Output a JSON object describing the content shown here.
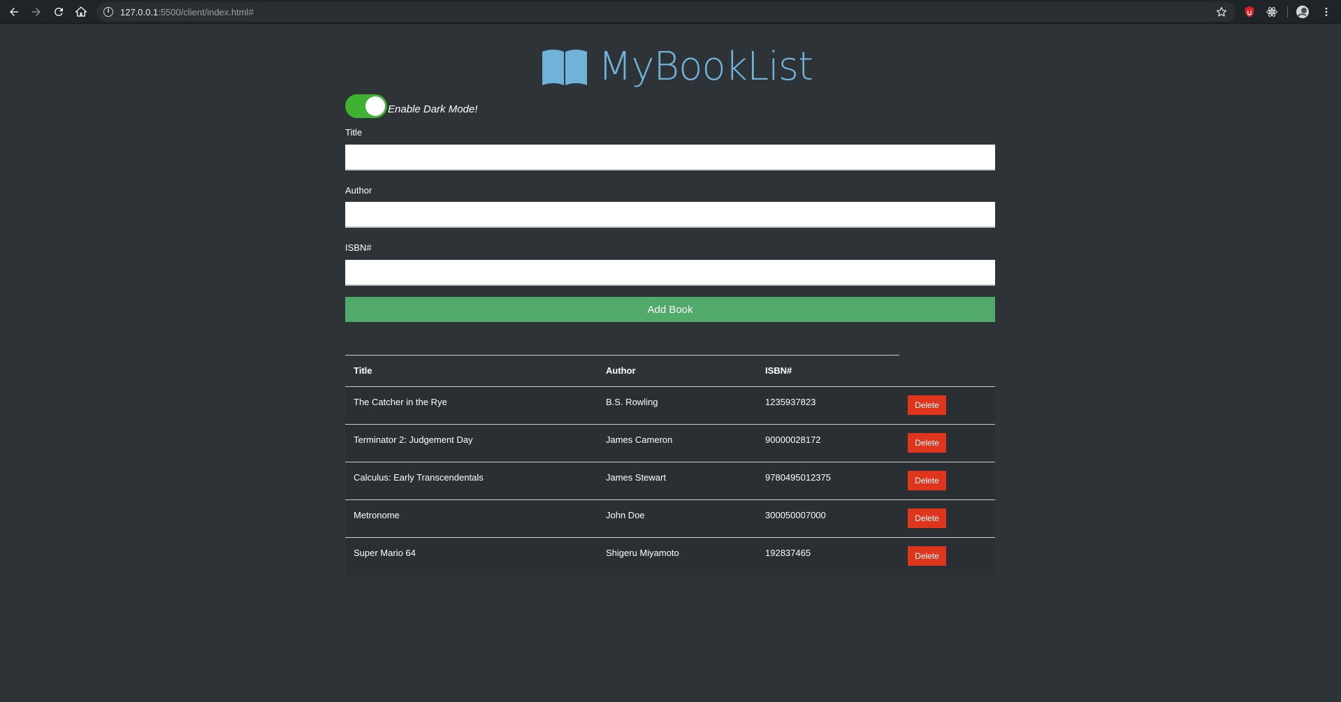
{
  "browser": {
    "url_host": "127.0.0.1",
    "url_path": ":5500/client/index.html#",
    "icons": [
      "back-arrow-icon",
      "forward-arrow-icon",
      "reload-icon",
      "home-icon",
      "info-icon",
      "star-icon",
      "shield-extension-icon",
      "react-extension-icon",
      "profile-icon",
      "menu-icon"
    ]
  },
  "header": {
    "title": "MyBookList",
    "logo_icon": "open-book-icon",
    "logo_color": "#6fb3d8"
  },
  "dark_mode": {
    "label": "Enable Dark Mode!",
    "enabled": true,
    "color": "#3fb331"
  },
  "form": {
    "title_label": "Title",
    "title_value": "",
    "author_label": "Author",
    "author_value": "",
    "isbn_label": "ISBN#",
    "isbn_value": "",
    "submit_label": "Add Book",
    "submit_color": "#52aa6a"
  },
  "table": {
    "headers": {
      "title": "Title",
      "author": "Author",
      "isbn": "ISBN#"
    },
    "delete_label": "Delete",
    "delete_color": "#e0351d",
    "rows": [
      {
        "title": "The Catcher in the Rye",
        "author": "B.S. Rowling",
        "isbn": "1235937823"
      },
      {
        "title": "Terminator 2: Judgement Day",
        "author": "James Cameron",
        "isbn": "90000028172"
      },
      {
        "title": "Calculus: Early Transcendentals",
        "author": "James Stewart",
        "isbn": "9780495012375"
      },
      {
        "title": "Metronome",
        "author": "John Doe",
        "isbn": "300050007000"
      },
      {
        "title": "Super Mario 64",
        "author": "Shigeru Miyamoto",
        "isbn": "192837465"
      }
    ]
  }
}
